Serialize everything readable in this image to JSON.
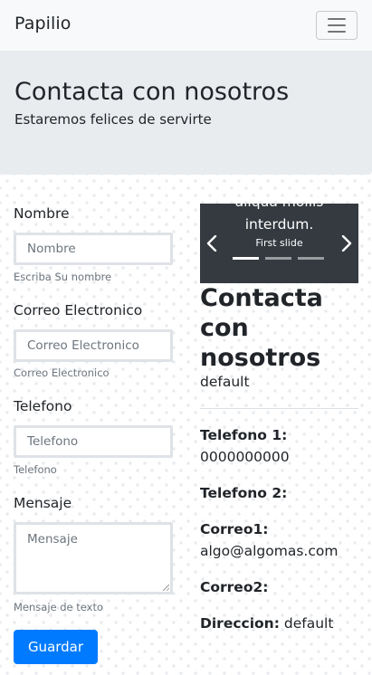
{
  "navbar": {
    "brand": "Papilio"
  },
  "jumbotron": {
    "title": "Contacta con nosotros",
    "subtitle": "Estaremos felices de servirte"
  },
  "form": {
    "nombre": {
      "label": "Nombre",
      "placeholder": "Nombre",
      "help": "Escriba Su nombre",
      "value": ""
    },
    "correo": {
      "label": "Correo Electronico",
      "placeholder": "Correo Electronico",
      "help": "Correo Electronico",
      "value": ""
    },
    "telefono": {
      "label": "Telefono",
      "placeholder": "Telefono",
      "help": "Telefono",
      "value": ""
    },
    "mensaje": {
      "label": "Mensaje",
      "placeholder": "Mensaje",
      "help": "Mensaje de texto",
      "value": ""
    },
    "submit_label": "Guardar"
  },
  "carousel": {
    "caption_lines": [
      "aliqua mollis",
      "interdum."
    ],
    "caption_sub": "First slide",
    "indicators": 3,
    "active_index": 0
  },
  "contact_info": {
    "title": "Contacta con nosotros",
    "subtitle": "default",
    "fields": [
      {
        "label": "Telefono 1:",
        "value": "0000000000"
      },
      {
        "label": "Telefono 2:",
        "value": ""
      },
      {
        "label": "Correo1:",
        "value": "algo@algomas.com"
      },
      {
        "label": "Correo2:",
        "value": ""
      },
      {
        "label": "Direccion:",
        "value": "default"
      }
    ]
  },
  "colors": {
    "primary": "#007bff",
    "navbar_bg": "#f8f9fa",
    "jumbotron_bg": "#e9ecef",
    "carousel_bg": "#343a40"
  }
}
